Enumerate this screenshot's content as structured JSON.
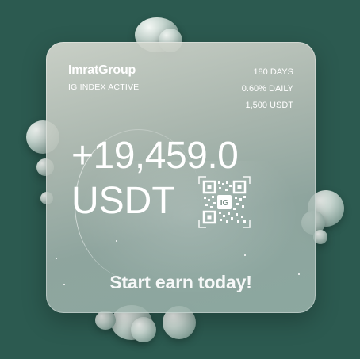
{
  "card": {
    "brand": "ImratGroup",
    "subtitle": "IG INDEX ACTIVE",
    "stats": [
      "180 DAYS",
      "0.60% DAILY",
      "1,500 USDT"
    ],
    "amount": "+19,459.0",
    "currency": "USDT",
    "qr_label": "IG",
    "cta": "Start earn today!"
  },
  "colors": {
    "background": "#2c5a50",
    "text": "#ffffff"
  }
}
